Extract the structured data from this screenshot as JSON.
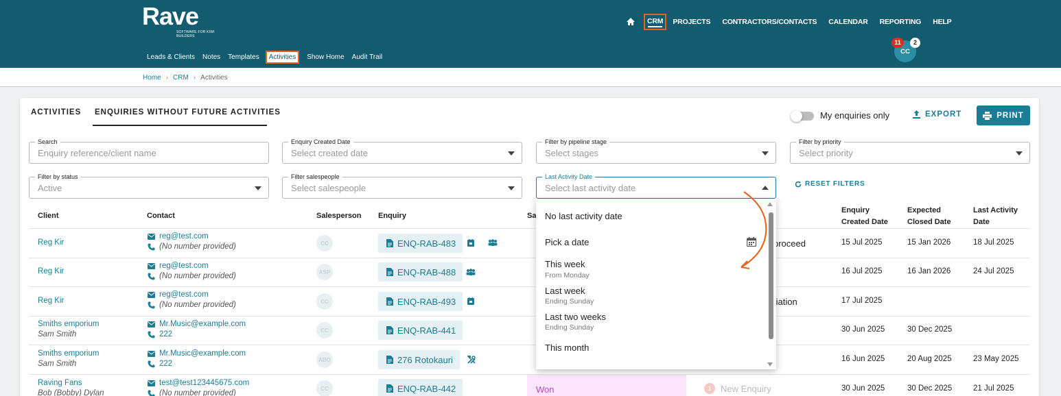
{
  "brand": {
    "name": "Rave",
    "tagline": "SOFTWARE FOR KIWI BUILDERS"
  },
  "main_nav": [
    "CRM",
    "PROJECTS",
    "CONTRACTORS/CONTACTS",
    "CALENDAR",
    "REPORTING",
    "HELP"
  ],
  "sub_nav": [
    "Leads & Clients",
    "Notes",
    "Templates",
    "Activities",
    "Show Home",
    "Audit Trail"
  ],
  "user": {
    "initials": "CC",
    "notif_red": "11",
    "notif_white": "2"
  },
  "breadcrumb": [
    "Home",
    "CRM",
    "Activities"
  ],
  "tabs": [
    "ACTIVITIES",
    "ENQUIRIES WITHOUT FUTURE ACTIVITIES"
  ],
  "toolbar": {
    "toggle_label": "My enquiries only",
    "export": "EXPORT",
    "print": "PRINT",
    "reset": "RESET FILTERS"
  },
  "filters": [
    {
      "label": "Search",
      "placeholder": "Enquiry reference/client name"
    },
    {
      "label": "Enquiry Created Date",
      "placeholder": "Select created date"
    },
    {
      "label": "Filter by pipeline stage",
      "placeholder": "Select stages"
    },
    {
      "label": "Filter by priority",
      "placeholder": "Select priority"
    },
    {
      "label": "Filter by status",
      "value": "Active"
    },
    {
      "label": "Filter salespeople",
      "placeholder": "Select salespeople"
    },
    {
      "label": "Last Activity Date",
      "placeholder": "Select last activity date"
    }
  ],
  "columns": {
    "client": "Client",
    "contact": "Contact",
    "salesperson": "Salesperson",
    "enquiry": "Enquiry",
    "stage_partial": "Sa",
    "created_1": "Enquiry",
    "created_2": "Created Date",
    "closed_1": "Expected",
    "closed_2": "Closed Date",
    "last_1": "Last Activity",
    "last_2": "Date"
  },
  "rows": [
    {
      "client": "Reg Kir",
      "client_sub": "",
      "email": "reg@test.com",
      "phone": "(No number provided)",
      "sp": "CC",
      "enquiry": "ENQ-RAB-483",
      "stage": "proceed",
      "created": "15 Jul 2025",
      "closed": "15 Jan 2026",
      "last": "18 Jul 2025"
    },
    {
      "client": "Reg Kir",
      "client_sub": "",
      "email": "reg@test.com",
      "phone": "(No number provided)",
      "sp": "ASP",
      "enquiry": "ENQ-RAB-488",
      "stage": "",
      "created": "16 Jul 2025",
      "closed": "16 Jan 2026",
      "last": "24 Jul 2025"
    },
    {
      "client": "Reg Kir",
      "client_sub": "",
      "email": "reg@test.com",
      "phone": "(No number provided)",
      "sp": "CC",
      "enquiry": "ENQ-RAB-493",
      "stage": "tiation",
      "created": "17 Jul 2025",
      "closed": "",
      "last": ""
    },
    {
      "client": "Smiths emporium",
      "client_sub": "Sam Smith",
      "email": "Mr.Music@example.com",
      "phone": "222",
      "sp": "CC",
      "enquiry": "ENQ-RAB-441",
      "stage": "",
      "created": "30 Jun 2025",
      "closed": "30 Dec 2025",
      "last": ""
    },
    {
      "client": "Smiths emporium",
      "client_sub": "Sam Smith",
      "email": "Mr.Music@example.com",
      "phone": "222",
      "sp": "ABO",
      "enquiry": "276 Rotokauri",
      "stage": "",
      "created": "16 Jun 2025",
      "closed": "20 Aug 2025",
      "last": "23 May 2025"
    },
    {
      "client": "Raving Fans",
      "client_sub": "Bob (Bobby) Dylan",
      "email": "test@test123445675.com",
      "phone": "(No number provided)",
      "sp": "CC",
      "enquiry": "ENQ-RAB-442",
      "stage_status": "Won",
      "stage_num": "1",
      "stage": "New Enquiry",
      "created": "30 Jun 2025",
      "closed": "30 Dec 2025",
      "last": "21 Jul 2025"
    }
  ],
  "menu": {
    "options": [
      {
        "label": "No last activity date"
      },
      {
        "label": "Pick a date"
      },
      {
        "label": "This week",
        "sub": "From Monday"
      },
      {
        "label": "Last week",
        "sub": "Ending Sunday"
      },
      {
        "label": "Last two weeks",
        "sub": "Ending Sunday"
      },
      {
        "label": "This month"
      }
    ]
  },
  "colors": {
    "header": "#135b6e",
    "accent": "#1a7d95",
    "highlight": "#e8621a",
    "won": "#c03ec8"
  }
}
